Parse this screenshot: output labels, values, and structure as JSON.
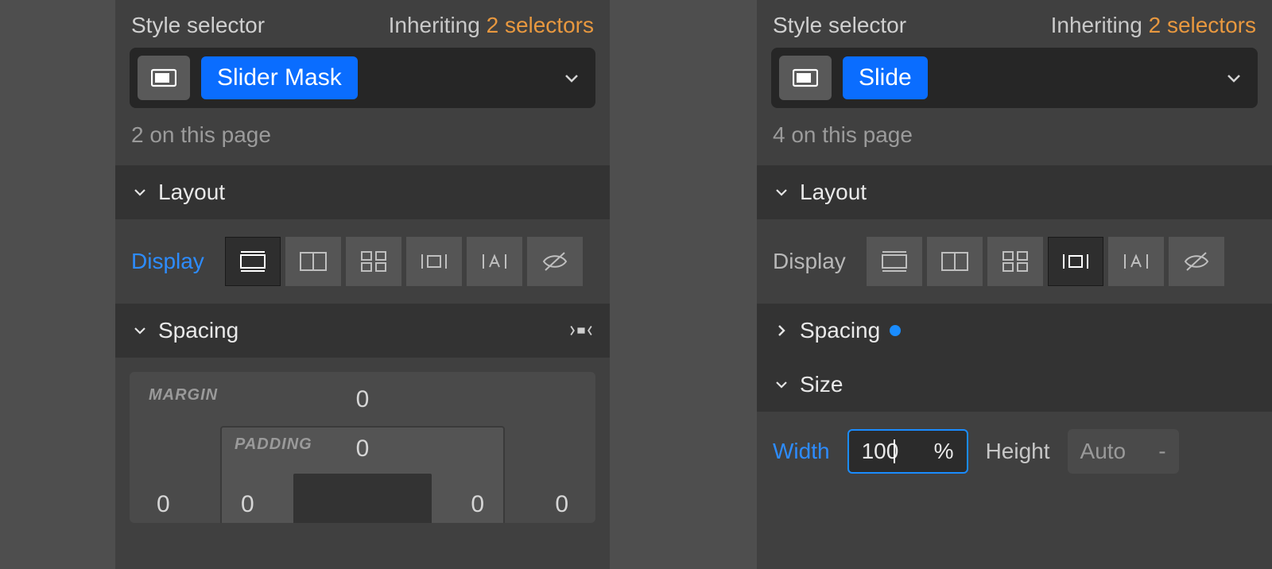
{
  "left": {
    "selector": {
      "title": "Style selector",
      "inheriting_label": "Inheriting",
      "inheriting_count": "2 selectors",
      "class_name": "Slider Mask",
      "on_page": "2 on this page"
    },
    "layout": {
      "heading": "Layout",
      "display_label": "Display",
      "active_highlight": true
    },
    "spacing": {
      "heading": "Spacing",
      "margin_label": "MARGIN",
      "padding_label": "PADDING",
      "margin_top": "0",
      "padding_top": "0",
      "margin_left": "0",
      "padding_left": "0",
      "padding_right": "0",
      "margin_right": "0"
    }
  },
  "right": {
    "selector": {
      "title": "Style selector",
      "inheriting_label": "Inheriting",
      "inheriting_count": "2 selectors",
      "class_name": "Slide",
      "on_page": "4 on this page"
    },
    "layout": {
      "heading": "Layout",
      "display_label": "Display",
      "active_highlight": false
    },
    "spacing": {
      "heading": "Spacing",
      "modified": true
    },
    "size": {
      "heading": "Size",
      "width_label": "Width",
      "width_value": "100",
      "width_unit": "%",
      "height_label": "Height",
      "height_value": "Auto",
      "height_unit": "-"
    }
  }
}
